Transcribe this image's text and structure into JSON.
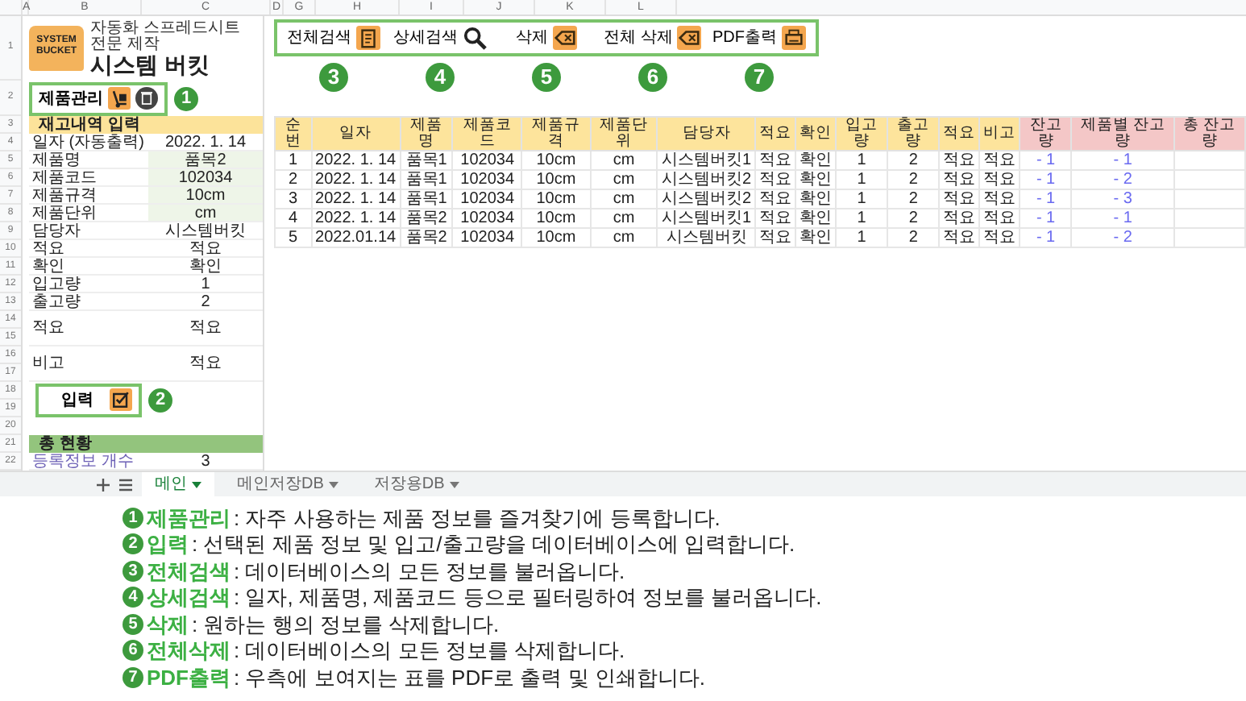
{
  "column_letters": [
    "A",
    "B",
    "C",
    "D",
    "G",
    "H",
    "I",
    "J",
    "K",
    "L"
  ],
  "row_numbers": [
    "1",
    "2",
    "3",
    "4",
    "5",
    "6",
    "7",
    "8",
    "9",
    "10",
    "11",
    "12",
    "13",
    "14",
    "15",
    "16",
    "17",
    "18",
    "19",
    "20",
    "21",
    "22"
  ],
  "logo": {
    "badge_text": "SYSTEM BUCKET",
    "tagline": "자동화 스프레드시트 전문 제작",
    "title": "시스템 버킷"
  },
  "product_button": {
    "label": "제품관리",
    "number": "1"
  },
  "entry": {
    "header": "재고내역 입력",
    "fields": [
      {
        "label": "일자 (자동출력)",
        "value": "2022. 1. 14",
        "highlighted": false,
        "tall": false
      },
      {
        "label": "제품명",
        "value": "품목2",
        "highlighted": true,
        "tall": false
      },
      {
        "label": "제품코드",
        "value": "102034",
        "highlighted": true,
        "tall": false
      },
      {
        "label": "제품규격",
        "value": "10cm",
        "highlighted": true,
        "tall": false
      },
      {
        "label": "제품단위",
        "value": "cm",
        "highlighted": true,
        "tall": false
      },
      {
        "label": "담당자",
        "value": "시스템버킷",
        "highlighted": false,
        "tall": false
      },
      {
        "label": "적요",
        "value": "적요",
        "highlighted": false,
        "tall": false
      },
      {
        "label": "확인",
        "value": "확인",
        "highlighted": false,
        "tall": false
      },
      {
        "label": "입고량",
        "value": "1",
        "highlighted": false,
        "tall": false
      },
      {
        "label": "출고량",
        "value": "2",
        "highlighted": false,
        "tall": false
      },
      {
        "label": "적요",
        "value": "적요",
        "highlighted": false,
        "tall": true
      },
      {
        "label": "비고",
        "value": "적요",
        "highlighted": false,
        "tall": true
      }
    ]
  },
  "input_button": {
    "label": "입력",
    "number": "2"
  },
  "summary": {
    "header": "총 현황",
    "rows": [
      {
        "label": "등록정보 개수",
        "value": "3"
      }
    ]
  },
  "toolbar": [
    {
      "label": "전체검색",
      "kind": "list",
      "number": "3"
    },
    {
      "label": "상세검색",
      "kind": "search",
      "number": "4"
    },
    {
      "label": "삭제",
      "kind": "delete",
      "number": "5"
    },
    {
      "label": "전체 삭제",
      "kind": "delete",
      "number": "6"
    },
    {
      "label": "PDF출력",
      "kind": "print",
      "number": "7"
    }
  ],
  "table": {
    "columns": [
      {
        "label": "순번",
        "kind": "input"
      },
      {
        "label": "일자",
        "kind": "input"
      },
      {
        "label": "제품명",
        "kind": "input"
      },
      {
        "label": "제품코드",
        "kind": "input"
      },
      {
        "label": "제품규격",
        "kind": "input"
      },
      {
        "label": "제품단위",
        "kind": "input"
      },
      {
        "label": "담당자",
        "kind": "input"
      },
      {
        "label": "적요",
        "kind": "input"
      },
      {
        "label": "확인",
        "kind": "input"
      },
      {
        "label": "입고량",
        "kind": "input"
      },
      {
        "label": "출고량",
        "kind": "input"
      },
      {
        "label": "적요",
        "kind": "input"
      },
      {
        "label": "비고",
        "kind": "input"
      },
      {
        "label": "잔고량",
        "kind": "balance"
      },
      {
        "label": "제품별 잔고량",
        "kind": "balance"
      },
      {
        "label": "총 잔고량",
        "kind": "balance"
      }
    ],
    "rows": [
      [
        "1",
        "2022. 1. 14",
        "품목1",
        "102034",
        "10cm",
        "cm",
        "시스템버킷1",
        "적요",
        "확인",
        "1",
        "2",
        "적요",
        "적요",
        "- 1",
        "- 1",
        ""
      ],
      [
        "2",
        "2022. 1. 14",
        "품목1",
        "102034",
        "10cm",
        "cm",
        "시스템버킷2",
        "적요",
        "확인",
        "1",
        "2",
        "적요",
        "적요",
        "- 1",
        "- 2",
        ""
      ],
      [
        "3",
        "2022. 1. 14",
        "품목1",
        "102034",
        "10cm",
        "cm",
        "시스템버킷2",
        "적요",
        "확인",
        "1",
        "2",
        "적요",
        "적요",
        "- 1",
        "- 3",
        ""
      ],
      [
        "4",
        "2022. 1. 14",
        "품목2",
        "102034",
        "10cm",
        "cm",
        "시스템버킷1",
        "적요",
        "확인",
        "1",
        "2",
        "적요",
        "적요",
        "- 1",
        "- 1",
        ""
      ],
      [
        "5",
        "2022.01.14",
        "품목2",
        "102034",
        "10cm",
        "cm",
        "시스템버킷",
        "적요",
        "확인",
        "1",
        "2",
        "적요",
        "적요",
        "- 1",
        "- 2",
        ""
      ]
    ]
  },
  "sheet_tabs": [
    {
      "label": "메인",
      "selected": true
    },
    {
      "label": "메인저장DB",
      "selected": false
    },
    {
      "label": "저장용DB",
      "selected": false
    }
  ],
  "legend": [
    {
      "number": "1",
      "term": "제품관리",
      "text": " : 자주 사용하는 제품 정보를 즐겨찾기에 등록합니다."
    },
    {
      "number": "2",
      "term": "입력",
      "text": " : 선택된 제품 정보 및 입고/출고량을 데이터베이스에 입력합니다."
    },
    {
      "number": "3",
      "term": "전체검색",
      "text": " : 데이터베이스의 모든 정보를 불러옵니다."
    },
    {
      "number": "4",
      "term": "상세검색",
      "text": " : 일자, 제품명, 제품코드 등으로 필터링하여 정보를 불러옵니다."
    },
    {
      "number": "5",
      "term": "삭제",
      "text": " : 원하는 행의 정보를 삭제합니다."
    },
    {
      "number": "6",
      "term": "전체삭제",
      "text": " : 데이터베이스의 모든 정보를 삭제합니다."
    },
    {
      "number": "7",
      "term": "PDF출력",
      "text": " : 우측에 보여지는 표를 PDF로 출력 및 인쇄합니다."
    }
  ]
}
